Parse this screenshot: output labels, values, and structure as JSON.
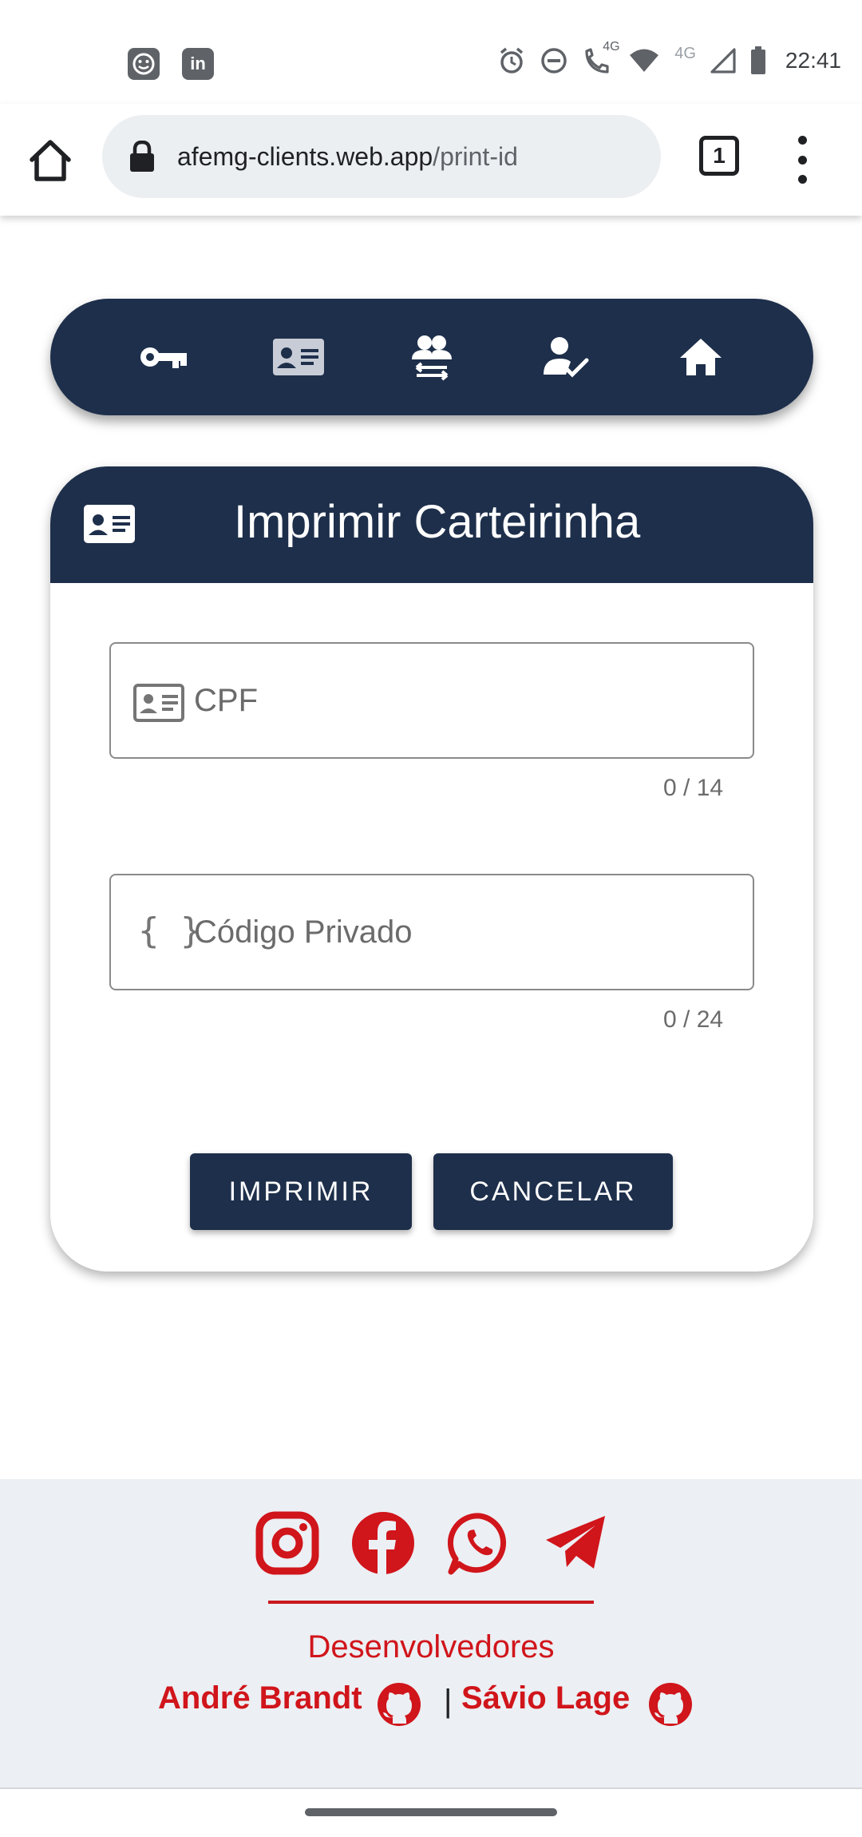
{
  "status_bar": {
    "time": "22:41",
    "network_label_1": "4G",
    "network_label_2": "4G",
    "left_apps": [
      "face-app-icon",
      "linkedin-icon"
    ],
    "linkedin_text": "in"
  },
  "browser": {
    "url_host": "afemg-clients.web.app",
    "url_path": "/print-id",
    "tab_count": "1"
  },
  "nav": {
    "items": [
      "key-icon",
      "id-card-icon",
      "users-exchange-icon",
      "user-check-icon",
      "home-icon"
    ]
  },
  "card": {
    "title": "Imprimir Carteirinha",
    "cpf": {
      "placeholder": "CPF",
      "value": "",
      "counter": "0 / 14"
    },
    "code": {
      "placeholder": "Código Privado",
      "value": "",
      "counter": "0 / 24",
      "icon_text": "{ }"
    },
    "print_button": "IMPRIMIR",
    "cancel_button": "CANCELAR"
  },
  "footer": {
    "social": [
      "instagram-icon",
      "facebook-icon",
      "whatsapp-icon",
      "telegram-icon"
    ],
    "developers_label": "Desenvolvedores",
    "dev1": "André Brandt",
    "separator": "|",
    "dev2": "Sávio Lage"
  },
  "colors": {
    "navy": "#1e2f4b",
    "red": "#d0151b",
    "footer_bg": "#eceff3"
  }
}
